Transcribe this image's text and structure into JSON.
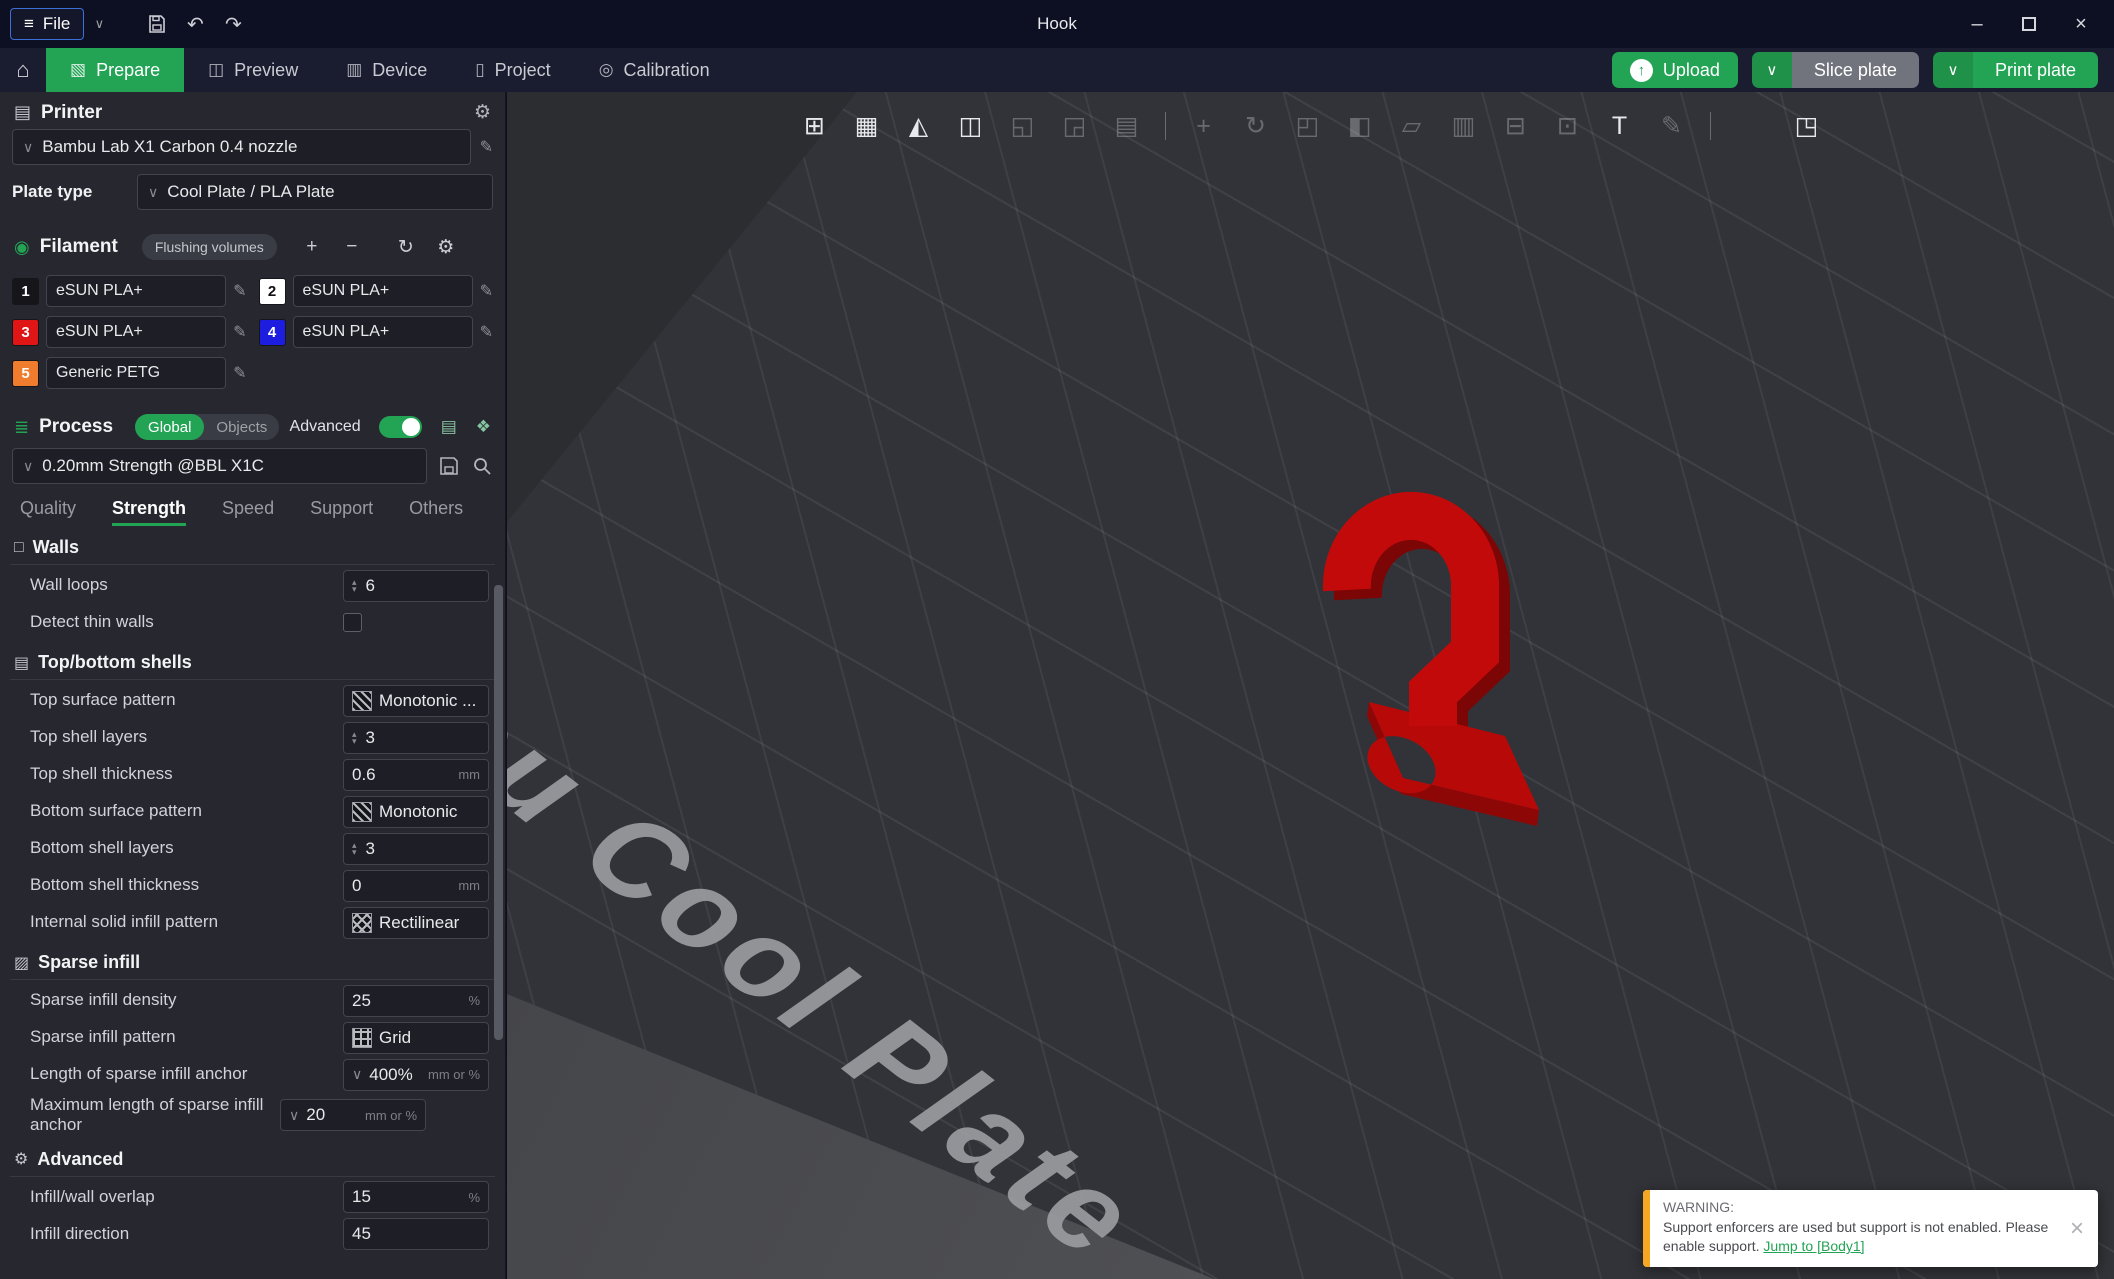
{
  "titlebar": {
    "file_label": "File",
    "title": "Hook"
  },
  "nav": {
    "tabs": [
      {
        "label": "Prepare"
      },
      {
        "label": "Preview"
      },
      {
        "label": "Device"
      },
      {
        "label": "Project"
      },
      {
        "label": "Calibration"
      }
    ],
    "upload_label": "Upload",
    "slice_label": "Slice plate",
    "print_label": "Print plate"
  },
  "printer": {
    "title": "Printer",
    "model": "Bambu Lab X1 Carbon 0.4 nozzle",
    "plate_type_label": "Plate type",
    "plate_type_value": "Cool Plate / PLA Plate"
  },
  "filament": {
    "title": "Filament",
    "flushing_label": "Flushing volumes",
    "slots": [
      {
        "index": "1",
        "name": "eSUN PLA+",
        "color": "#16161a",
        "text_color": "#ffffff"
      },
      {
        "index": "2",
        "name": "eSUN PLA+",
        "color": "#ffffff",
        "text_color": "#111111"
      },
      {
        "index": "3",
        "name": "eSUN PLA+",
        "color": "#e01515",
        "text_color": "#ffffff"
      },
      {
        "index": "4",
        "name": "eSUN PLA+",
        "color": "#1d1de0",
        "text_color": "#ffffff"
      },
      {
        "index": "5",
        "name": "Generic PETG",
        "color": "#f07c2e",
        "text_color": "#ffffff"
      }
    ]
  },
  "process": {
    "title": "Process",
    "global_label": "Global",
    "objects_label": "Objects",
    "advanced_label": "Advanced",
    "preset": "0.20mm Strength @BBL X1C",
    "tabs": [
      {
        "label": "Quality"
      },
      {
        "label": "Strength"
      },
      {
        "label": "Speed"
      },
      {
        "label": "Support"
      },
      {
        "label": "Others"
      }
    ],
    "active_tab": "Strength"
  },
  "params": {
    "walls_title": "Walls",
    "wall_loops_label": "Wall loops",
    "wall_loops_value": "6",
    "detect_thin_walls_label": "Detect thin walls",
    "shells_title": "Top/bottom shells",
    "top_surface_pattern_label": "Top surface pattern",
    "top_surface_pattern_value": "Monotonic ...",
    "top_shell_layers_label": "Top shell layers",
    "top_shell_layers_value": "3",
    "top_shell_thickness_label": "Top shell thickness",
    "top_shell_thickness_value": "0.6",
    "bottom_surface_pattern_label": "Bottom surface pattern",
    "bottom_surface_pattern_value": "Monotonic",
    "bottom_shell_layers_label": "Bottom shell layers",
    "bottom_shell_layers_value": "3",
    "bottom_shell_thickness_label": "Bottom shell thickness",
    "bottom_shell_thickness_value": "0",
    "internal_solid_label": "Internal solid infill pattern",
    "internal_solid_value": "Rectilinear",
    "sparse_title": "Sparse infill",
    "sparse_density_label": "Sparse infill density",
    "sparse_density_value": "25",
    "sparse_pattern_label": "Sparse infill pattern",
    "sparse_pattern_value": "Grid",
    "anchor_label": "Length of sparse infill anchor",
    "anchor_value": "400%",
    "anchor_max_label": "Maximum length of sparse infill anchor",
    "anchor_max_value": "20",
    "advanced_title": "Advanced",
    "overlap_label": "Infill/wall overlap",
    "overlap_value": "15",
    "infill_direction_label": "Infill direction",
    "infill_direction_value": "45",
    "unit_mm": "mm",
    "unit_percent": "%",
    "unit_mm_or_percent": "mm or %"
  },
  "viewport": {
    "plate_text": "Bambu Cool Plate",
    "model_color": "#c20a0a",
    "model_shadow_color": "#7c0505",
    "model_plate_color": "#b80909",
    "model_side_color": "#8e0707"
  },
  "warning": {
    "label": "WARNING:",
    "message": "Support enforcers are used but support is not enabled. Please enable support. ",
    "link": "Jump to [Body1]"
  },
  "icons": {
    "menu": "≡",
    "chevron_down": "∨",
    "undo": "↶",
    "redo": "↷",
    "minimize": "–",
    "close": "×",
    "home": "⌂",
    "tab_prepare": "▧",
    "tab_preview": "◫",
    "tab_device": "▥",
    "tab_project": "▯",
    "tab_calibration": "◎",
    "upload_arrow": "↑",
    "gear": "⚙",
    "printer": "▤",
    "edit": "✎",
    "filament": "◉",
    "plus": "+",
    "minus": "−",
    "refresh": "↻",
    "process": "≣",
    "list": "▤",
    "tree": "❖",
    "spin_up": "▴",
    "spin_down": "▾",
    "walls": "□",
    "shells": "▤",
    "sparse": "▨",
    "advanced": "⚙",
    "t_add": "⊞",
    "t_plate": "▦",
    "t_auto": "◭",
    "t_arrange": "◫",
    "t_copy": "◱",
    "t_paste": "◲",
    "t_layers": "▤",
    "t_move": "+",
    "t_rotate": "↻",
    "t_scale": "◰",
    "t_mirror": "◧",
    "t_flat": "▱",
    "t_cut": "▥",
    "t_align": "⊟",
    "t_frame": "⊡",
    "t_text": "T",
    "t_seam": "✎",
    "t_assembly": "◳",
    "warn_close": "×"
  }
}
